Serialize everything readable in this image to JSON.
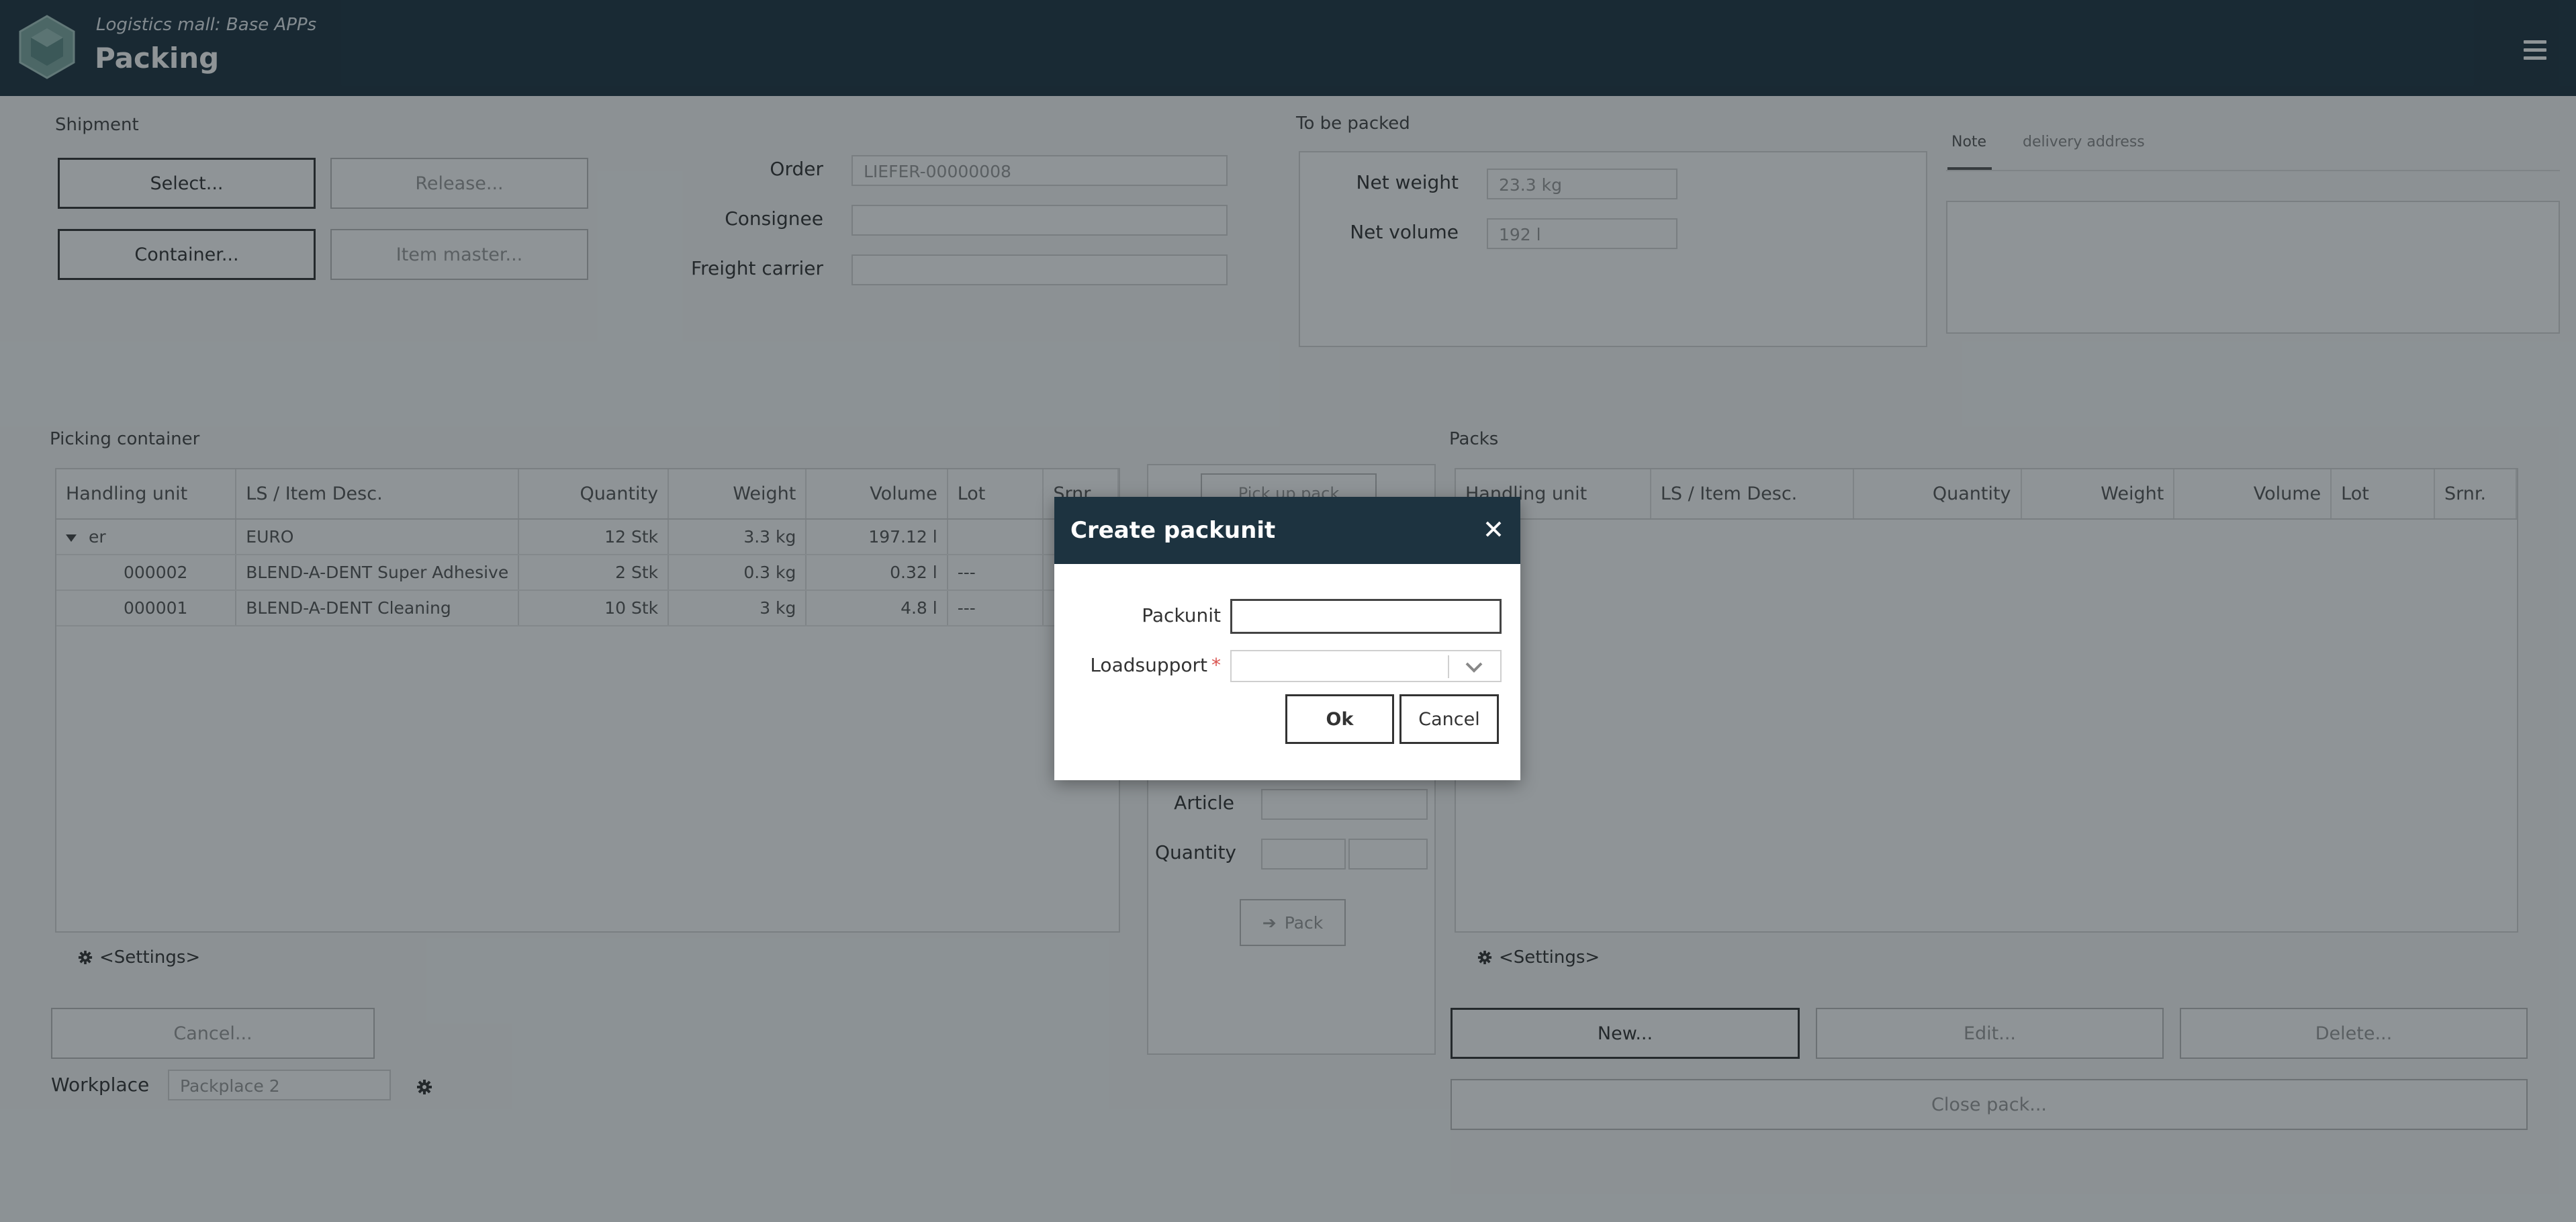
{
  "header": {
    "app_subtitle": "Logistics mall: Base APPs",
    "app_title": "Packing"
  },
  "shipment": {
    "title": "Shipment",
    "select_button": "Select...",
    "release_button": "Release...",
    "container_button": "Container...",
    "item_master_button": "Item master..."
  },
  "order_info": {
    "order_label": "Order",
    "order_value": "LIEFER-00000008",
    "consignee_label": "Consignee",
    "consignee_value": "",
    "freight_label": "Freight carrier",
    "freight_value": ""
  },
  "to_be_packed": {
    "title": "To be packed",
    "net_weight_label": "Net weight",
    "net_weight_value": "23.3 kg",
    "net_volume_label": "Net volume",
    "net_volume_value": "192 l"
  },
  "notes": {
    "tab_note": "Note",
    "tab_delivery": "delivery address"
  },
  "picking": {
    "title": "Picking container",
    "columns": [
      "Handling unit",
      "LS / Item Desc.",
      "Quantity",
      "Weight",
      "Volume",
      "Lot",
      "Srnr."
    ],
    "rows": [
      {
        "hu": "er",
        "desc": "EURO",
        "qty": "12 Stk",
        "weight": "3.3 kg",
        "volume": "197.12 l",
        "lot": "",
        "srnr": ""
      },
      {
        "hu": "000002",
        "desc": "BLEND-A-DENT Super Adhesive",
        "qty": "2 Stk",
        "weight": "0.3 kg",
        "volume": "0.32 l",
        "lot": "---",
        "srnr": ""
      },
      {
        "hu": "000001",
        "desc": "BLEND-A-DENT Cleaning",
        "qty": "10 Stk",
        "weight": "3 kg",
        "volume": "4.8 l",
        "lot": "---",
        "srnr": ""
      }
    ],
    "settings": "<Settings>"
  },
  "middle": {
    "pick_button": "Pick up pack",
    "article_label": "Article",
    "quantity_label": "Quantity",
    "pack_button": "Pack"
  },
  "packs": {
    "title": "Packs",
    "columns": [
      "Handling unit",
      "LS / Item Desc.",
      "Quantity",
      "Weight",
      "Volume",
      "Lot",
      "Srnr."
    ],
    "settings": "<Settings>",
    "new_button": "New...",
    "edit_button": "Edit...",
    "delete_button": "Delete...",
    "close_pack_button": "Close pack..."
  },
  "bottom": {
    "cancel_button": "Cancel...",
    "workplace_label": "Workplace",
    "workplace_value": "Packplace 2"
  },
  "dialog": {
    "title": "Create packunit",
    "packunit_label": "Packunit",
    "packunit_value": "",
    "loadsupport_label": "Loadsupport",
    "required_mark": "*",
    "ok_button": "Ok",
    "cancel_button": "Cancel"
  },
  "colors": {
    "header_bg": "#1d3340",
    "overlay": "rgba(20,32,38,0.48)",
    "required": "#d9534f"
  }
}
